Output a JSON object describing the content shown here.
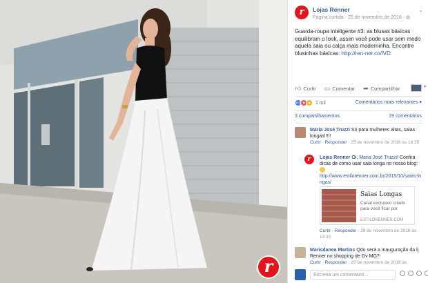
{
  "page": {
    "name": "Lojas Renner",
    "meta": "Página curtida · 25 de novembro de 2016 ·",
    "logo_letter": "r"
  },
  "post": {
    "text": "Guarda-roupa inteligente #3: as blusas básicas equilibram o look, assim você pode usar sem medo aquela saia ou calça mais moderninha. Encontre blusinhas básicas: ",
    "link": "http://ren-ner.co/lVD"
  },
  "actions": {
    "like": "Curtir",
    "comment": "Comentar",
    "share": "Compartilhar"
  },
  "reactions": {
    "count": "1 mil",
    "sort": "Comentários mais relevantes",
    "shares": "3 compartilhamentos",
    "comments_count": "19 comentários"
  },
  "comments": [
    {
      "author": "Maria José Truzzi",
      "text": "Só para mulheres altas, saias longas!!!!!",
      "like": "Curtir",
      "reply": "Responder",
      "date": "25 de novembro de 2016 às 18:35"
    },
    {
      "author": "Lojas Renner",
      "text_before": "Oi, ",
      "mention": "Maria José Truzzi",
      "text_after": "! Confira dicas de como usar saia longa no nosso blog:",
      "url": "http://www.estilorenner.com.br/2015/10/saias-longas/",
      "like": "Curtir",
      "reply": "Responder",
      "date": "28 de novembro de 2016 às 13:30"
    },
    {
      "author": "Marisdanea Martins",
      "text": "Qdo será a inauguração da lj Renner no shopping de Gv MG?",
      "like": "Curtir",
      "reply": "Responder",
      "date": "25 de novembro de 2016 às"
    }
  ],
  "link_card": {
    "title": "Saias Longas",
    "description": "Canal exclusivo criado para você ficar por",
    "domain": "ESTILORENNER.COM"
  },
  "reply_box": {
    "placeholder": "Escreva um comentário..."
  },
  "colors": {
    "brand_red": "#e3141b",
    "link_blue": "#365899"
  }
}
